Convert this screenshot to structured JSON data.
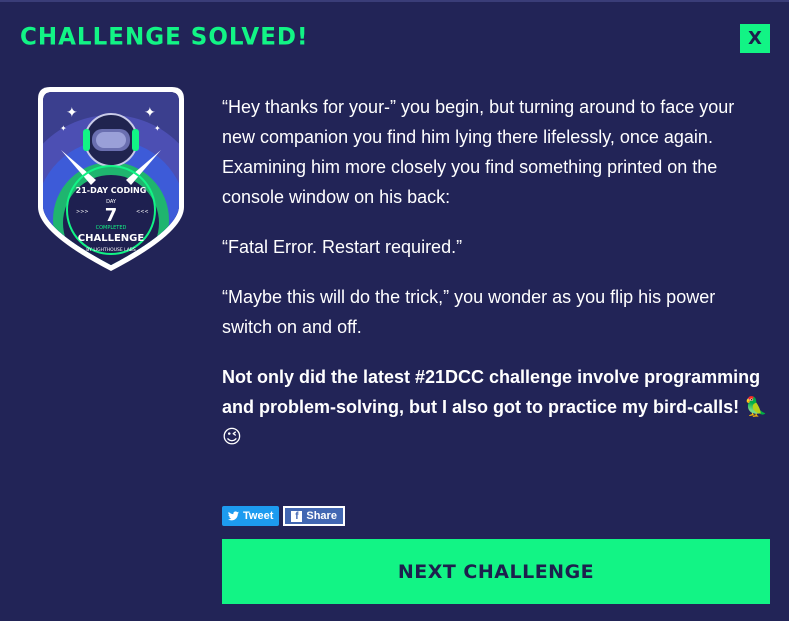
{
  "header": {
    "title": "CHALLENGE SOLVED!",
    "close_label": "X"
  },
  "badge": {
    "top_text": "21-DAY CODING",
    "day_label": "DAY",
    "day_number": "7",
    "completed_label": "COMPLETED",
    "bottom_text": "CHALLENGE",
    "footer_text": "BY LIGHTHOUSE LABS",
    "arrows_left": ">>>",
    "arrows_right": "<<<"
  },
  "story": {
    "paragraphs": [
      "“Hey thanks for your-” you begin, but turning around to face your new companion you find him lying there lifelessly, once again. Examining him more closely you find something printed on the console window on his back:",
      "“Fatal Error. Restart required.”",
      "“Maybe this will do the trick,” you wonder as you flip his power switch on and off."
    ],
    "highlight": "Not only did the latest #21DCC challenge involve programming and problem-solving, but I also got to practice my bird-calls!",
    "highlight_emoji": "🦜😉"
  },
  "share": {
    "tweet_label": "Tweet",
    "share_label": "Share",
    "tweet_icon": "twitter-bird-icon",
    "share_icon": "facebook-f-icon"
  },
  "next_button": {
    "label": "NEXT CHALLENGE"
  },
  "colors": {
    "background": "#222457",
    "accent": "#12f485",
    "dark_text": "#1d1f4d",
    "twitter": "#1d9bf0",
    "facebook": "#4267b2"
  }
}
